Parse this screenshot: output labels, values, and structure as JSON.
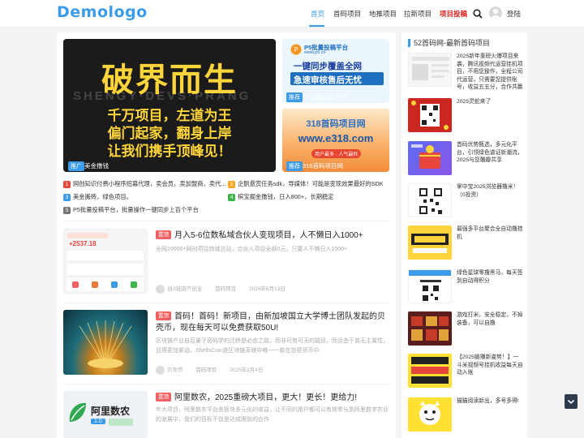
{
  "site": {
    "logo": "Demologo",
    "login": "登陆"
  },
  "nav": [
    {
      "label": "首页",
      "state": "active"
    },
    {
      "label": "首码项目",
      "state": ""
    },
    {
      "label": "地推项目",
      "state": ""
    },
    {
      "label": "拉新项目",
      "state": ""
    },
    {
      "label": "项目投稿",
      "state": "hot"
    }
  ],
  "slider": {
    "big": "破界而生",
    "line1": "千万项目，左道为王",
    "line2": "偏门起家，翻身上岸",
    "line3": "让我们携手顶峰见！",
    "watermark": "SHENGY·DEVS·PRANG",
    "tag": "推广",
    "caption": "美金撸钱"
  },
  "ad1": {
    "brand": "P5批量投稿平台",
    "site": "www.p5.cn",
    "line1": "一键同步覆盖全网",
    "line2": "急速审核售后无忧",
    "tag": "推荐",
    "caption": "P5批量投稿平台"
  },
  "ad2": {
    "line1": "318首码项目网",
    "line2": "www.e318.com",
    "sub": "用户最多 · 人气最旺",
    "tag": "推荐",
    "caption": "318首码项目网"
  },
  "quicklinks": [
    {
      "n": "1",
      "text": "网创知识付费小程序招募代理，卖会员，卖加盟商，卖代...",
      "color": "#e8453c"
    },
    {
      "n": "2",
      "text": "企鹅悬赏任务sdk，导媒体！可能是变现效果最好的SDK",
      "color": "#f5a623"
    },
    {
      "n": "3",
      "text": "美金搬砖，绿色项目。",
      "color": "#3b9be8"
    },
    {
      "n": "4",
      "text": "槟宝掘金撸钱，日入800+，长期稳定",
      "color": "#3cb54a"
    },
    {
      "n": "5",
      "text": "P5批量投稿平台，批量操作一键同步上百个平台",
      "color": "#777777"
    }
  ],
  "posts": [
    {
      "badge": "置顶",
      "title": "月入5-6位数私域合伙人变现项目，人不懒日入1000+",
      "desc": "全网10000+网创项目商城总站，合伙人项目全部0元，只要人不懒日入1000+",
      "author": "创A轻资产创业",
      "category": "首码项目",
      "date": "2024年6月13日",
      "thumb": {
        "amount": "+2537.18"
      }
    },
    {
      "badge": "置顶",
      "title": "首码！首码！新项目，由新加坡国立大学博士团队发起的贝壳币，现在每天可以免费获取50U!",
      "desc": "区块链产业自后量子密码学的迁移是必由之路，而非可有可无的路径，而且由于其无主属性，显得更加紧迫。ShellsCoin是区块链系统中唯一一款在加密货币中",
      "author": "贝壳币",
      "category": "首码项目",
      "date": "2025年2月4日"
    },
    {
      "badge": "置顶",
      "title": "阿里数农，2025重磅大项目，更大！更长！更给力!",
      "desc": "年大项目，阿里数农平台各板块多元化的收益，让不同的用户都可以有效参与到阿里数字农业的发展中，我们的目标不仅是达成眼前的合作",
      "thumb": {
        "brand": "阿里数农",
        "ver": "1.0"
      }
    }
  ],
  "sidebar": {
    "title": "52首码网-最新首码项目",
    "items": [
      {
        "text": "2025新年重磅火爆项目来袭，腾讯视频代运营挂机项目，不用您操作，全程公司代运营，只需要您提供账号，收益五五分，合作共赢"
      },
      {
        "text": "2025灵蛇来了"
      },
      {
        "text": "首码优势甄选，多元化平台，引领绿色谱证新潮流，2025与您雕瓣共享"
      },
      {
        "text": "掌中宝2025浏览器撸米！（0投资）"
      },
      {
        "text": "最强多平台聚合全自动撸挂机"
      },
      {
        "text": "绿色星球零撸黑马，每天签到自动得积分"
      },
      {
        "text": "游戏打米，安全稳定，不掉装备，可以自撸"
      },
      {
        "text": "【2025躺赚新姿势！】一斗米视频号挂机收益每天自动入账"
      },
      {
        "text": "猫猫阅读新出，多号多得!"
      }
    ]
  },
  "colors": {
    "accent": "#3b9be8",
    "hot": "#e02020",
    "badge": "#f16060"
  }
}
